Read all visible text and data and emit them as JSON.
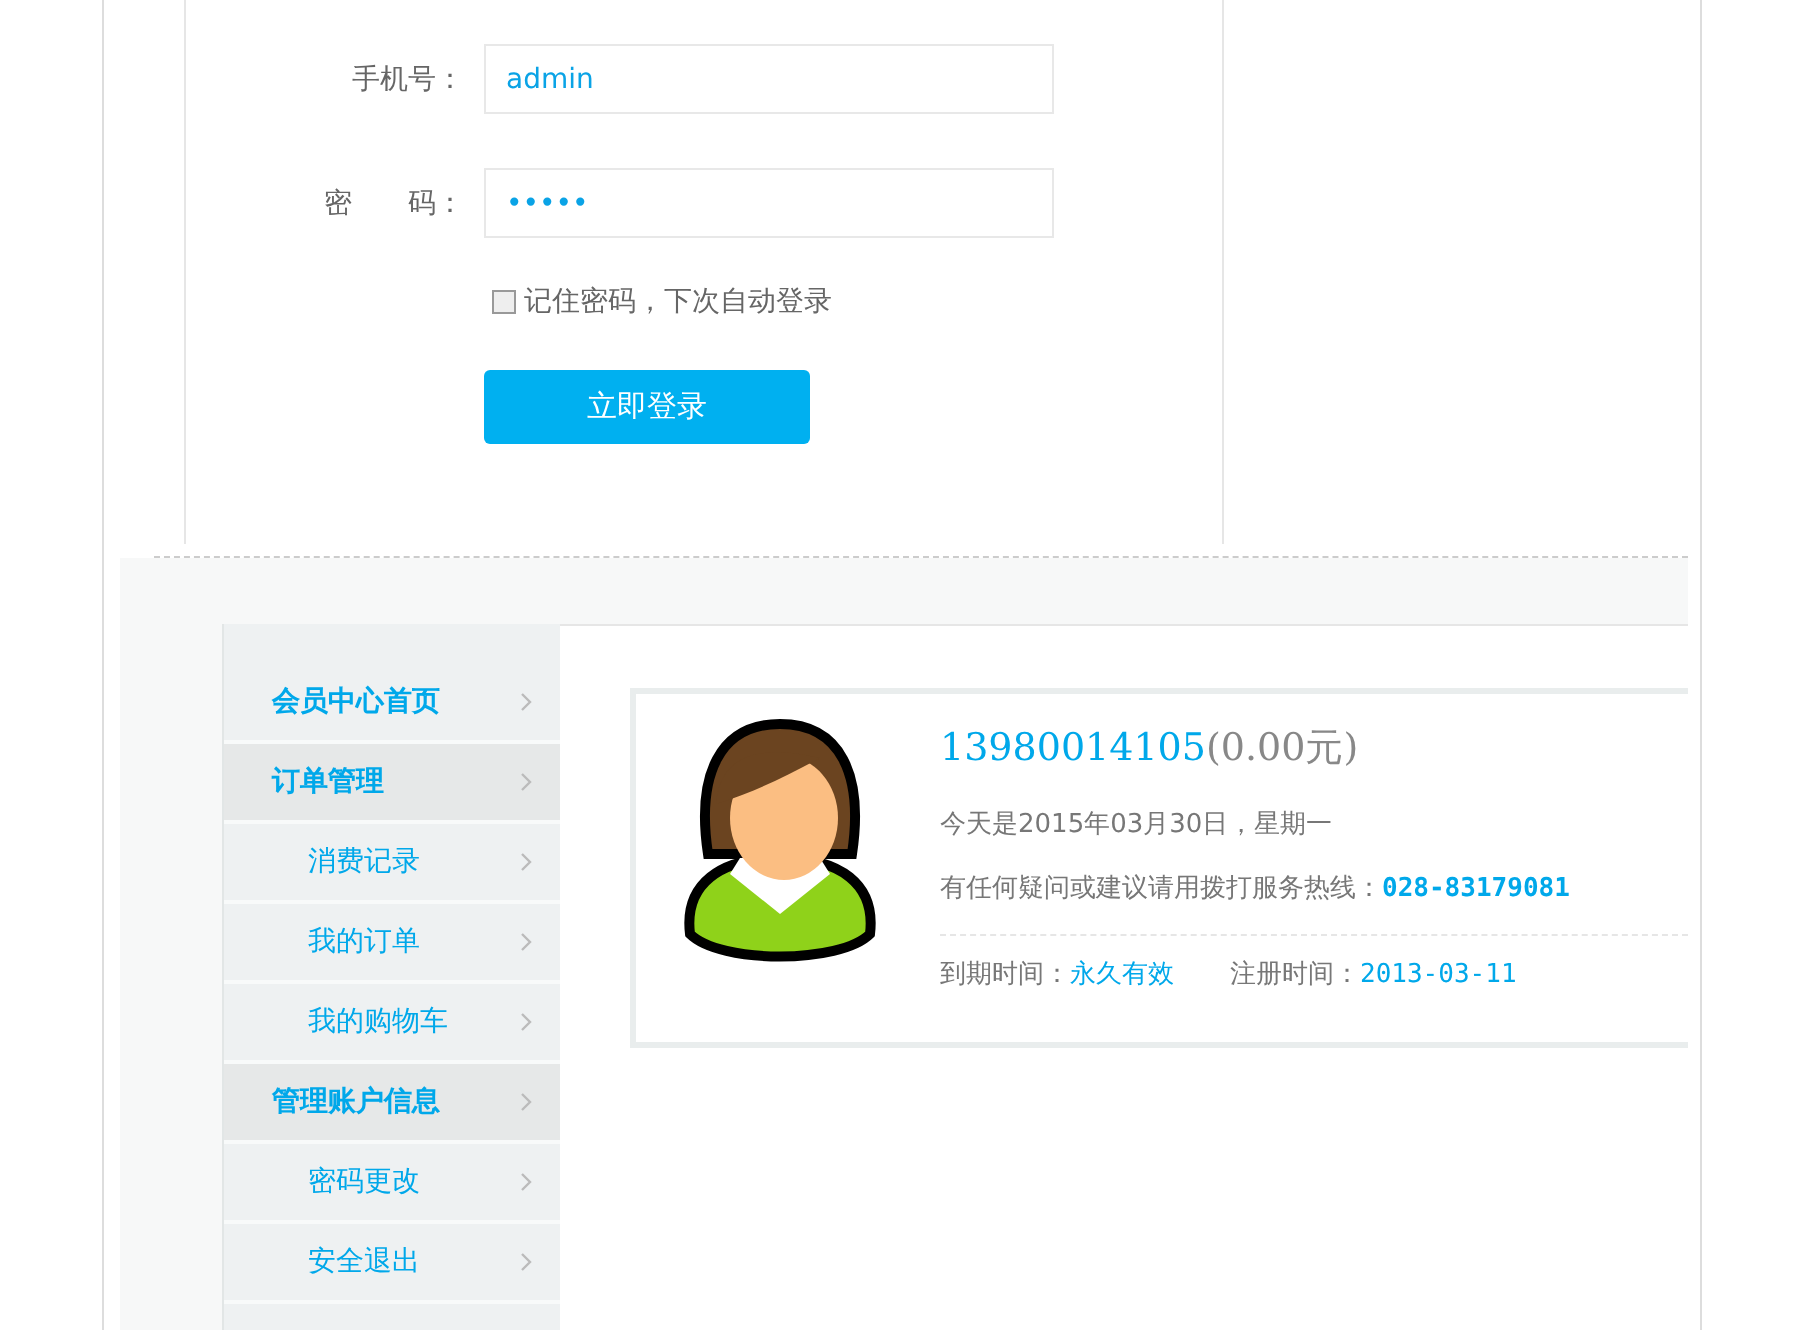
{
  "login": {
    "fields": [
      {
        "label": "手机号：",
        "value": "admin"
      },
      {
        "label": "密　　码：",
        "value": "•••••"
      }
    ],
    "remember": {
      "label": "记住密码，下次自动登录",
      "checked": false
    },
    "submit": "立即登录"
  },
  "sidebar": {
    "items": [
      {
        "label": "会员中心首页",
        "kind": "top"
      },
      {
        "label": "订单管理",
        "kind": "group"
      },
      {
        "label": "消费记录",
        "kind": "sub"
      },
      {
        "label": "我的订单",
        "kind": "sub"
      },
      {
        "label": "我的购物车",
        "kind": "sub"
      },
      {
        "label": "管理账户信息",
        "kind": "group"
      },
      {
        "label": "密码更改",
        "kind": "sub"
      },
      {
        "label": "安全退出",
        "kind": "sub"
      }
    ]
  },
  "profile": {
    "account": "13980014105",
    "balance": "(0.00元)",
    "today": "今天是2015年03月30日，星期一",
    "hotline_label": "有任何疑问或建议请用拨打服务热线：",
    "hotline": "028-83179081",
    "expiry_label": "到期时间：",
    "expiry": "永久有效",
    "registered_label": "注册时间：",
    "registered": "2013-03-11"
  }
}
